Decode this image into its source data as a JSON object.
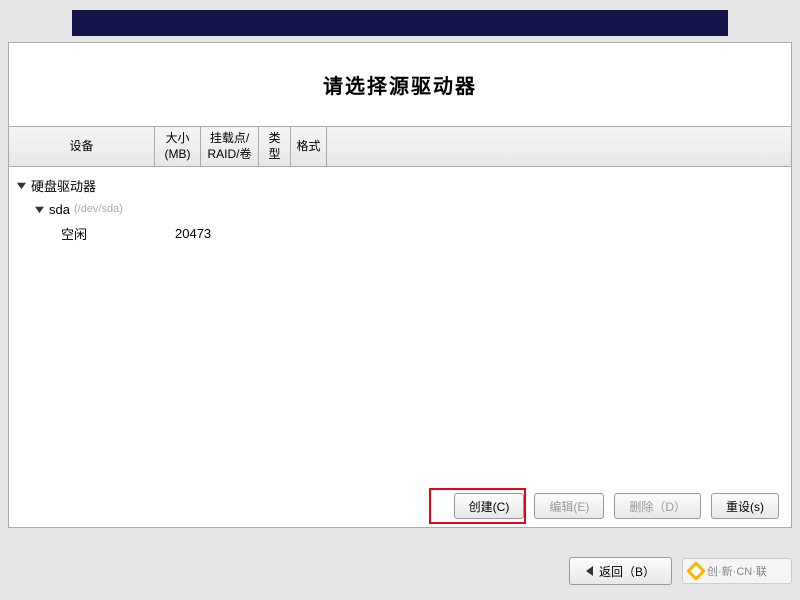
{
  "title": "请选择源驱动器",
  "columns": {
    "device": "设备",
    "size": "大小\n(MB)",
    "mount": "挂载点/\nRAID/卷",
    "type": "类型",
    "format": "格式"
  },
  "tree": {
    "root_label": "硬盘驱动器",
    "disk_label": "sda",
    "disk_path": "(/dev/sda)",
    "free_label": "空闲",
    "free_size": "20473"
  },
  "actions": {
    "create": "创建(C)",
    "edit": "编辑(E)",
    "delete": "删除（D）",
    "reset": "重设(s)"
  },
  "nav": {
    "back": "返回（B）"
  },
  "watermark": "创·新·CN·联"
}
